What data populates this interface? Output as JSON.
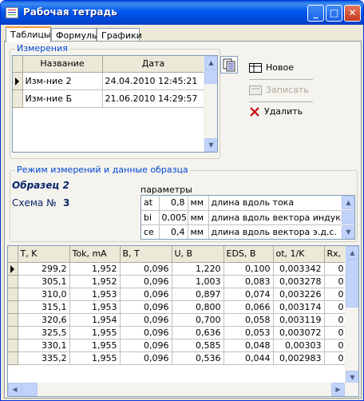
{
  "window": {
    "title": "Рабочая тетрадь"
  },
  "tabs": [
    {
      "label": "Таблицы",
      "active": true
    },
    {
      "label": "Формулы",
      "active": false
    },
    {
      "label": "Графики",
      "active": false
    }
  ],
  "measurements": {
    "caption": "Измерения",
    "columns": [
      "Название",
      "Дата"
    ],
    "rows": [
      {
        "name": "Изм-ние 2",
        "date": "24.04.2010 12:45:21",
        "current": true
      },
      {
        "name": "Изм-ние Б",
        "date": "21.06.2010 14:29:57",
        "current": false
      }
    ]
  },
  "actions": {
    "new_label": "Новое",
    "save_label": "Записать",
    "delete_label": "Удалить"
  },
  "sample": {
    "caption": "Режим измерений и данные образца",
    "name": "Образец 2",
    "scheme_label": "Схема №",
    "scheme_value": "3",
    "params_label": "параметры",
    "params": [
      {
        "key": "at",
        "value": "0,8",
        "unit": "мм",
        "desc": "длина вдоль тока"
      },
      {
        "key": "bi",
        "value": "0,005",
        "unit": "мм",
        "desc": "длина вдоль вектора индукции"
      },
      {
        "key": "ce",
        "value": "0,4",
        "unit": "мм",
        "desc": "длина вдоль вектора э.д.с."
      }
    ]
  },
  "data_table": {
    "columns": [
      "T, K",
      "Tok, mA",
      "B, T",
      "U, B",
      "EDS, B",
      "ot, 1/K",
      "Rx,"
    ],
    "rows": [
      [
        "299,2",
        "1,952",
        "0,096",
        "1,220",
        "0,100",
        "0,003342",
        "0"
      ],
      [
        "305,1",
        "1,952",
        "0,096",
        "1,003",
        "0,083",
        "0,003278",
        "0"
      ],
      [
        "310,0",
        "1,953",
        "0,096",
        "0,897",
        "0,074",
        "0,003226",
        "0"
      ],
      [
        "315,1",
        "1,953",
        "0,096",
        "0,800",
        "0,066",
        "0,003174",
        "0"
      ],
      [
        "320,6",
        "1,954",
        "0,096",
        "0,700",
        "0,058",
        "0,003119",
        "0"
      ],
      [
        "325,5",
        "1,955",
        "0,096",
        "0,636",
        "0,053",
        "0,003072",
        "0"
      ],
      [
        "330,1",
        "1,955",
        "0,096",
        "0,585",
        "0,048",
        "0,00303",
        "0"
      ],
      [
        "335,2",
        "1,955",
        "0,096",
        "0,536",
        "0,044",
        "0,002983",
        "0"
      ]
    ]
  }
}
